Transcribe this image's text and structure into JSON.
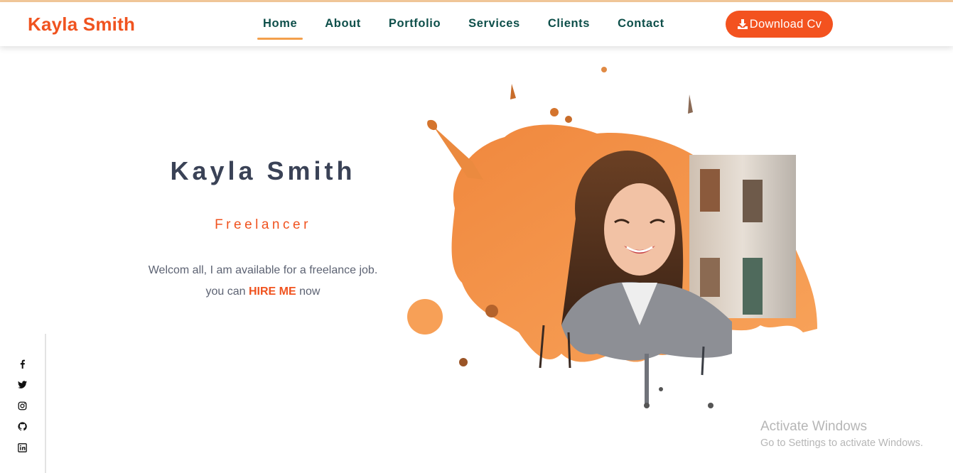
{
  "header": {
    "brand": "Kayla Smith",
    "nav": [
      {
        "label": "Home",
        "active": true
      },
      {
        "label": "About"
      },
      {
        "label": "Portfolio"
      },
      {
        "label": "Services"
      },
      {
        "label": "Clients"
      },
      {
        "label": "Contact"
      }
    ],
    "download_label": "Download Cv"
  },
  "hero": {
    "name": "Kayla Smith",
    "role": "Freelancer",
    "line1": "Welcom all, I am available for a freelance job.",
    "line2_pre": "you can ",
    "line2_hire": "HIRE ME",
    "line2_post": " now"
  },
  "social": [
    "facebook-icon",
    "twitter-icon",
    "instagram-icon",
    "github-icon",
    "linkedin-icon"
  ],
  "watermark": {
    "title": "Activate Windows",
    "subtitle": "Go to Settings to activate Windows."
  },
  "colors": {
    "brand": "#f0531f",
    "nav_text": "#0e4f4a",
    "nav_active_underline": "#f3a04c",
    "button": "#f3521f",
    "heading": "#3a4256",
    "splash_orange": "#f39a4e"
  }
}
